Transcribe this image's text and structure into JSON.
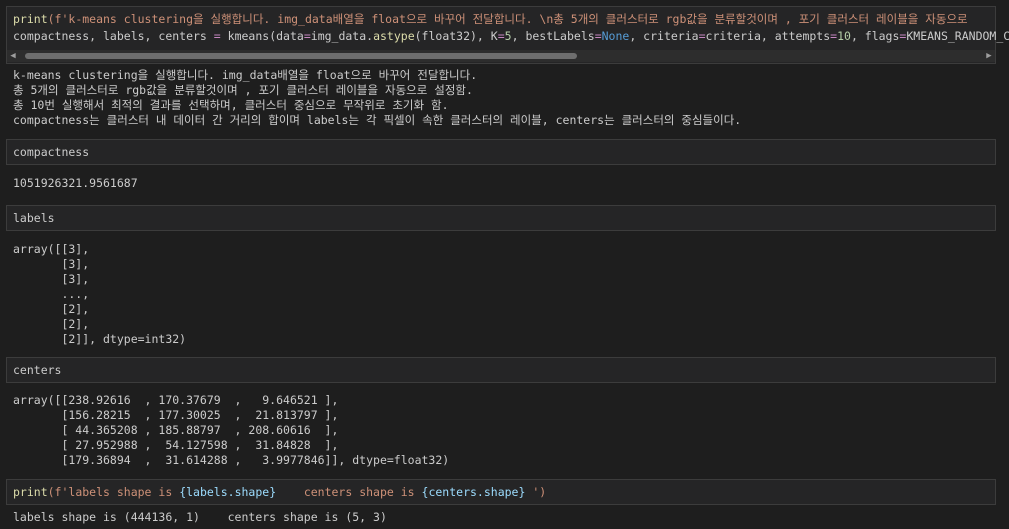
{
  "cell1": {
    "line1": {
      "fn": "print",
      "str": "(f'k-means clustering을 실행합니다. img_data배열을 float으로 바꾸어 전달합니다. \\n총 5개의 클러스터로 rgb값을 분류할것이며 , 포기 클러스터 레이블을 자동으로"
    },
    "line2": {
      "t1": "compactness, labels, centers ",
      "eq": "=",
      "t2": " kmeans(data",
      "eq2": "=",
      "t3": "img_data.",
      "method": "astype",
      "t4": "(float32), K",
      "eq3": "=",
      "k": "5",
      "t5": ", bestLabels",
      "eq4": "=",
      "none": "None",
      "t6": ", criteria",
      "eq5": "=",
      "t7": "criteria, attempts",
      "eq6": "=",
      "att": "10",
      "t8": ", flags",
      "eq7": "=",
      "flag": "KMEANS_RANDOM_CENTERS)"
    }
  },
  "output1": [
    "k-means clustering을 실행합니다. img_data배열을 float으로 바꾸어 전달합니다.",
    "총 5개의 클러스터로 rgb값을 분류할것이며 , 포기 클러스터 레이블을 자동으로 설정함.",
    "총 10번 실행해서 최적의 결과를 선택하며, 클러스터 중심으로 무작위로 초기화 함.",
    "compactness는 클러스터 내 데이터 간 거리의 합이며 labels는 각 픽셀이 속한 클러스터의 레이블, centers는 클러스터의 중심들이다."
  ],
  "cell2": {
    "code": "compactness"
  },
  "output2": "1051926321.9561687",
  "cell3": {
    "code": "labels"
  },
  "output3": [
    "array([[3],",
    "       [3],",
    "       [3],",
    "       ...,",
    "       [2],",
    "       [2],",
    "       [2]], dtype=int32)"
  ],
  "cell4": {
    "code": "centers"
  },
  "output4": [
    "array([[238.92616  , 170.37679  ,   9.646521 ],",
    "       [156.28215  , 177.30025  ,  21.813797 ],",
    "       [ 44.365208 , 185.88797  , 208.60616  ],",
    "       [ 27.952988 ,  54.127598 ,  31.84828  ],",
    "       [179.36894  ,  31.614288 ,   3.9977846]], dtype=float32)"
  ],
  "cell5": {
    "fn": "print",
    "s1": "(f'labels shape is ",
    "v1": "{labels.shape}",
    "s2": "    centers shape is ",
    "v2": "{centers.shape}",
    "s3": " ')"
  },
  "output5": "labels shape is (444136, 1)    centers shape is (5, 3)"
}
